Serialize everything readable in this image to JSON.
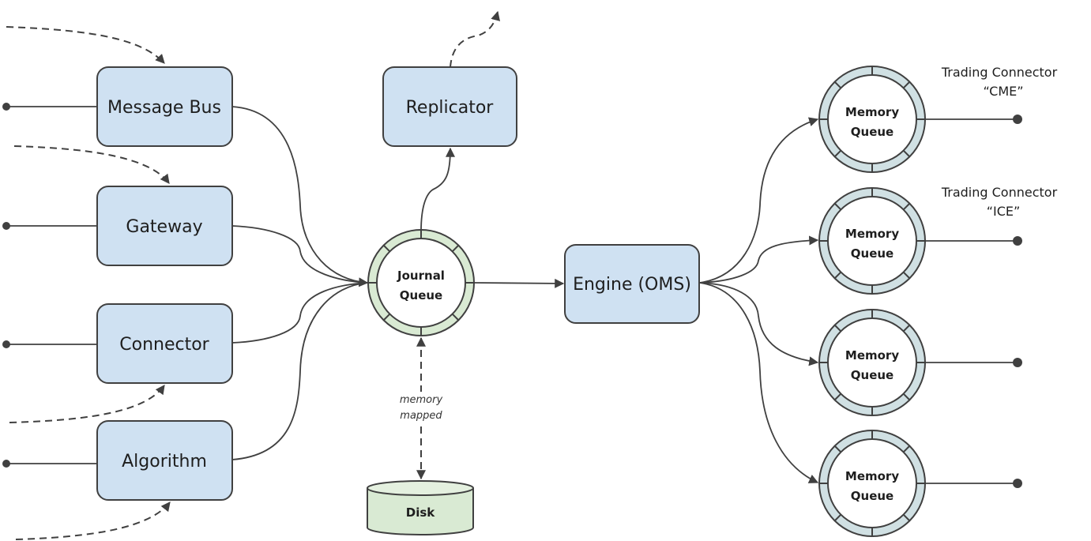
{
  "diagram": {
    "colors": {
      "box_fill": "#cfe1f2",
      "stroke": "#404040",
      "journal_ring": "#d9ead3",
      "memory_ring": "#d0e0e3",
      "disk_fill": "#d9ead3"
    },
    "sources": [
      {
        "id": "message-bus",
        "label": "Message Bus"
      },
      {
        "id": "gateway",
        "label": "Gateway"
      },
      {
        "id": "connector",
        "label": "Connector"
      },
      {
        "id": "algorithm",
        "label": "Algorithm"
      }
    ],
    "replicator": {
      "label": "Replicator"
    },
    "journal_queue": {
      "line1": "Journal",
      "line2": "Queue"
    },
    "edge_label": {
      "line1": "memory",
      "line2": "mapped"
    },
    "disk": {
      "label": "Disk"
    },
    "engine": {
      "label": "Engine (OMS)"
    },
    "memory_queues": [
      {
        "line1": "Memory",
        "line2": "Queue",
        "connector_line1": "Trading Connector",
        "connector_line2": "“CME”"
      },
      {
        "line1": "Memory",
        "line2": "Queue",
        "connector_line1": "Trading Connector",
        "connector_line2": "“ICE”"
      },
      {
        "line1": "Memory",
        "line2": "Queue",
        "connector_line1": "",
        "connector_line2": ""
      },
      {
        "line1": "Memory",
        "line2": "Queue",
        "connector_line1": "",
        "connector_line2": ""
      }
    ]
  }
}
